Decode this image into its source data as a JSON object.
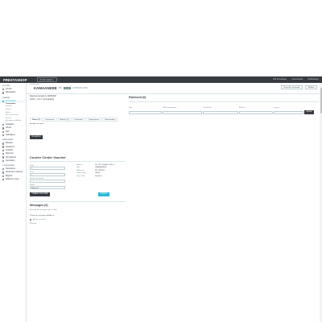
{
  "topbar": {
    "logo": "PRESTASHOP",
    "quick_access": "Accès rapide ▾",
    "right_links": [
      "Voir la boutique",
      "Commandes",
      "Notifications"
    ]
  },
  "sidebar": {
    "sections": [
      {
        "head": "Accueil",
        "items": [
          {
            "label": "Accueil"
          },
          {
            "label": "Marketplace"
          }
        ]
      },
      {
        "head": "Vendre",
        "items": [
          {
            "label": "Commandes",
            "active": true,
            "subs": [
              "Commandes",
              "Factures",
              "Paniers",
              "Avoirs",
              "Bons de livraison",
              "Paniers",
              "Messages prédéfinis"
            ]
          },
          {
            "label": "Catalogue"
          },
          {
            "label": "Clients"
          },
          {
            "label": "SAV"
          },
          {
            "label": "Statistiques"
          }
        ]
      },
      {
        "head": "Améliorer",
        "items": [
          {
            "label": "Modules"
          },
          {
            "label": "Apparence"
          },
          {
            "label": "Livraison"
          },
          {
            "label": "Paiement"
          },
          {
            "label": "International"
          },
          {
            "label": "Facturation"
          }
        ]
      },
      {
        "head": "Configurer",
        "items": [
          {
            "label": "Paramètres"
          },
          {
            "label": "Paramètres avancés"
          },
          {
            "label": "Rapport"
          },
          {
            "label": "Réduire le menu"
          }
        ]
      }
    ]
  },
  "header": {
    "breadcrumb": "Commandes  /",
    "back": "←",
    "reference": "KAMAANEEB",
    "order_id": "#46",
    "status": "Annulé",
    "date": "10/09/2022 10:35",
    "buttons": [
      "Nouvelle commande",
      "Modifier"
    ]
  },
  "left": {
    "customer_lines": [
      "Paiement accepté le 12/09/2022",
      "Vérifié : 1 sur 1 commande(s)"
    ],
    "tabs": [
      "Statut (1)",
      "Documents",
      "Retours (0)",
      "Paiements",
      "Transporteurs",
      "Marchandise"
    ],
    "tab_active_content": "Envoyer un email",
    "save_button": "Enregistrer",
    "voucher_title": "Courier Center Voucher",
    "voucher": {
      "left_labels": [
        "Poids",
        "Colis",
        "Nombre de paquets",
        "Bultos"
      ],
      "left_values": [
        "1",
        "1",
        "",
        "Etiqueta 1"
      ],
      "right_labels": [
        "Adresse",
        "Nom",
        "Référence",
        "Code postal",
        "Pays / Ville"
      ],
      "right_values": [
        "Dir. 18, Cristóbal Colón, 7",
        "GRANADA ES",
        "PE 1234567",
        "18000",
        "Imprimer"
      ],
      "create_button": "CRÉER VOUCHER",
      "print_button": "Imprimer"
    },
    "messages_title": "Messages (0)",
    "messages_hint": "Échange de messages avec le client",
    "message_select": "Choisir un message prédéfini ▾",
    "message_checkbox": "Afficher au client ?",
    "message_label": "Message"
  },
  "right": {
    "title": "Paiement (0)",
    "columns": [
      "Date",
      "Mode de paiement",
      "Transaction",
      "Montant",
      "Facture"
    ],
    "add_button": "Ajouter"
  }
}
